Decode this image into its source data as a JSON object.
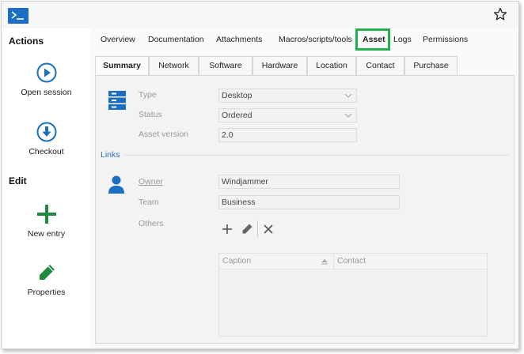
{
  "colors": {
    "accent": "#1b6ec2",
    "highlight": "#22b14c",
    "add_icon": "#1f8a3d",
    "edit_icon": "#1f8a3d"
  },
  "titlebar": {
    "logo_icon": "terminal-icon",
    "favorite_icon": "star-icon"
  },
  "sidebar": {
    "sections": [
      {
        "heading": "Actions",
        "items": [
          {
            "label": "Open session",
            "icon": "play-circle-icon"
          },
          {
            "label": "Checkout",
            "icon": "download-circle-icon"
          }
        ]
      },
      {
        "heading": "Edit",
        "items": [
          {
            "label": "New entry",
            "icon": "plus-icon"
          },
          {
            "label": "Properties",
            "icon": "pencil-icon"
          }
        ]
      }
    ]
  },
  "top_tabs": [
    "Overview",
    "Documentation",
    "Attachments",
    "Macros/scripts/tools",
    "Asset",
    "Logs",
    "Permissions"
  ],
  "active_top_tab": "Asset",
  "sub_tabs": [
    "Summary",
    "Network",
    "Software",
    "Hardware",
    "Location",
    "Contact",
    "Purchase"
  ],
  "active_sub_tab": "Summary",
  "asset": {
    "type_label": "Type",
    "type_value": "Desktop",
    "status_label": "Status",
    "status_value": "Ordered",
    "version_label": "Asset version",
    "version_value": "2.0"
  },
  "links": {
    "section_title": "Links",
    "owner_label": "Owner",
    "owner_value": "Windjammer",
    "team_label": "Team",
    "team_value": "Business",
    "others_label": "Others",
    "grid": {
      "columns": [
        "Caption",
        "Contact"
      ]
    }
  }
}
